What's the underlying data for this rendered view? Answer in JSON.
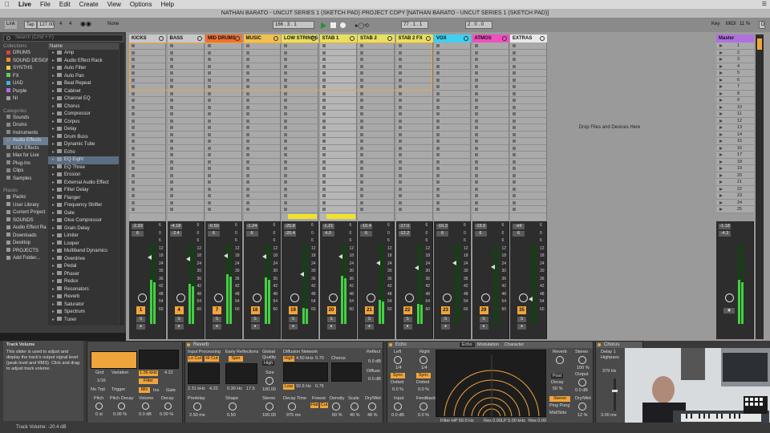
{
  "menubar": {
    "app": "Live",
    "items": [
      "File",
      "Edit",
      "Create",
      "View",
      "Options",
      "Help"
    ]
  },
  "title": "NATHAN BARATO - UNCUT SERIES 1 (SKETCH PAD) PROJECT COPY  [NATHAN BARATO - UNCUT SERIES 1 (SKETCH PAD)]",
  "transport": {
    "link": "Link",
    "tap": "Tap",
    "tempo": "127.00",
    "sig_num": "4",
    "sig_den": "4",
    "quant": "None",
    "pos": "166 .  3 .  1",
    "loop_start": "1",
    "loop_len": "77 .  1 .  1",
    "pos2": "2 .  0 .  0",
    "key": "Key",
    "midi": "MIDI",
    "cpu": "11 %",
    "d": "D"
  },
  "search": {
    "placeholder": "Search (Cmd + F)"
  },
  "sidebar": {
    "collections_h": "Collections",
    "collections": [
      {
        "label": "DRUMS",
        "color": "#e04040"
      },
      {
        "label": "SOUND DESIGN",
        "color": "#f08a30"
      },
      {
        "label": "SYNTHS",
        "color": "#e8d040"
      },
      {
        "label": "FX",
        "color": "#5ad05a"
      },
      {
        "label": "UAD",
        "color": "#40b0e0"
      },
      {
        "label": "Purple",
        "color": "#b070e0"
      },
      {
        "label": "NI",
        "color": "#a0a0a0"
      }
    ],
    "categories_h": "Categories",
    "categories": [
      "Sounds",
      "Drums",
      "Instruments",
      "Audio Effects",
      "MIDI Effects",
      "Max for Live",
      "Plug-Ins",
      "Clips",
      "Samples"
    ],
    "places_h": "Places",
    "places": [
      "Packs",
      "User Library",
      "Current Project",
      "SOUNDS",
      "Audio Effect Ra",
      "Downloads",
      "Desktop",
      "PROJECTS",
      "Add Folder..."
    ]
  },
  "browser": {
    "name_header": "Name",
    "items": [
      "Amp",
      "Audio Effect Rack",
      "Auto Filter",
      "Auto Pan",
      "Beat Repeat",
      "Cabinet",
      "Channel EQ",
      "Chorus",
      "Compressor",
      "Corpus",
      "Delay",
      "Drum Buss",
      "Dynamic Tube",
      "Echo",
      "EQ Eight",
      "EQ Three",
      "Erosion",
      "External Audio Effect",
      "Filter Delay",
      "Flanger",
      "Frequency Shifter",
      "Gate",
      "Glue Compressor",
      "Grain Delay",
      "Limiter",
      "Looper",
      "Multiband Dynamics",
      "Overdrive",
      "Pedal",
      "Phaser",
      "Redux",
      "Resonators",
      "Reverb",
      "Saturator",
      "Spectrum",
      "Tuner"
    ],
    "selected": "EQ Eight"
  },
  "tracks": [
    {
      "name": "KICKS",
      "color": "#c8c8c8",
      "vol": "-2.33",
      "pan": "6",
      "num": "1",
      "meter": 0.55
    },
    {
      "name": "BASS",
      "color": "#c8c8c8",
      "vol": "-4.18",
      "pan": "-2.4",
      "num": "4",
      "meter": 0.5
    },
    {
      "name": "MID DRUMS",
      "color": "#f07030",
      "vol": "-0.50",
      "pan": "6",
      "num": "7",
      "meter": 0.62
    },
    {
      "name": "MUSIC",
      "color": "#f0c050",
      "vol": "-1.24",
      "pan": "6",
      "num": "18",
      "meter": 0.58
    },
    {
      "name": "LOW STRINGS",
      "color": "#e8e060",
      "vol": "-25.8",
      "pan": "-20.4",
      "num": "19",
      "meter": 0.2
    },
    {
      "name": "STAB 1",
      "color": "#e8e060",
      "vol": "-1.21",
      "pan": "4.0",
      "num": "20",
      "meter": 0.6
    },
    {
      "name": "STAB 2",
      "color": "#e8e060",
      "vol": "-10.4",
      "pan": "6",
      "num": "21",
      "meter": 0.3
    },
    {
      "name": "STAB 2 FX",
      "color": "#e8e060",
      "vol": "-17.0",
      "pan": "-12.2",
      "num": "22",
      "meter": 0.25
    },
    {
      "name": "VOX",
      "color": "#40d0f0",
      "vol": "-10.3",
      "pan": "6",
      "num": "23",
      "meter": 0
    },
    {
      "name": "ATMOS",
      "color": "#f050c0",
      "vol": "-15.5",
      "pan": "6",
      "num": "29",
      "meter": 0
    },
    {
      "name": "EXTRAS",
      "color": "#e8e8e8",
      "vol": "-inf",
      "pan": "6",
      "num": "35",
      "meter": 0
    }
  ],
  "scale": [
    "6",
    "0",
    "6",
    "12",
    "18",
    "24",
    "30",
    "36",
    "42",
    "48",
    "54",
    "60"
  ],
  "drop_text": "Drop Files and Devices Here",
  "master": {
    "name": "Master",
    "vol": "-1.18",
    "pan": "-4.3",
    "scenes": [
      "1",
      "2",
      "3",
      "4",
      "5",
      "6",
      "7",
      "8",
      "9",
      "10",
      "11",
      "12",
      "13",
      "14",
      "15",
      "16",
      "17",
      "18",
      "19",
      "20",
      "21",
      "22",
      "23",
      "24",
      "25"
    ]
  },
  "info": {
    "title": "Track Volume",
    "body": "This slider is used to adjust and display the track's output signal level (peak level and RMS). Click and drag to adjust track volume."
  },
  "status": "Track Volume: -20.4 dB",
  "devices": {
    "track_volume": {
      "grid": "Grid",
      "variation": "Variation",
      "freq": "1.56 kHz",
      "val": "4.22",
      "no_trpl": "No Trpl",
      "trigger": "Trigger",
      "filter": "Filter",
      "mix": "Mix",
      "ins": "Ins",
      "gate": "Gate",
      "pitch": "Pitch",
      "pitch_decay": "Pitch Decay",
      "volume": "Volume",
      "decay": "Decay",
      "pitch_v": "0 st",
      "pd_v": "0.00 %",
      "vol_v": "0.0 dB",
      "dec_v": "0.00 %",
      "g1": "1/16"
    },
    "reverb": {
      "title": "Reverb",
      "input": "Input Processing",
      "early": "Early Reflections",
      "global": "Global",
      "quality": "Quality",
      "high": "High",
      "diffusion": "Diffusion Network",
      "reflect": "Reflect",
      "lo_cut": "Lo Cut",
      "hi_cut": "Hi Cut",
      "spin": "Spin",
      "f1": "2.31 kHz",
      "v1": "4.22",
      "f2": "0.30 Hz",
      "v2": "17.5",
      "size": "Size",
      "size_v": "100.00",
      "high_l": "High",
      "hf": "4.50 kHz",
      "hv": "0.70",
      "chorus": "Chorus",
      "low": "Low",
      "lf": "92.6 Hz",
      "lv": "0.75",
      "diffuse": "Diffuse",
      "predelay": "Predelay",
      "predelay_v": "2.50 ms",
      "shape": "Shape",
      "shape_v": "0.50",
      "stereo": "Stereo",
      "stereo_v": "100.00",
      "decay_time": "Decay Time",
      "decay_v": "975 ms",
      "freeze": "Freeze",
      "flat": "Flat",
      "cut": "Cut",
      "density": "Density",
      "density_v": "60 %",
      "scale": "Scale",
      "scale_v": "40 %",
      "drywet": "Dry/Wet",
      "drywet_v": "48 %",
      "reflect_v": "0.0 dB",
      "diffuse_v": "0.0 dB"
    },
    "echo": {
      "title": "Echo",
      "tabs": [
        "Echo",
        "Modulation",
        "Character"
      ],
      "left": "Left",
      "right": "Right",
      "l_div": "1/4",
      "r_div": "1/4",
      "sync": "Sync",
      "dotted": "Dotted",
      "l_pct": "0.0 %",
      "r_pct": "0.0 %",
      "input": "Input",
      "input_v": "0.0 dB",
      "feedback": "Feedback",
      "feedback_v": "0.0 %",
      "filter": "Filter HP 50.0 Hz",
      "res1": "Res 0.00",
      "lp": "LP 5.00 kHz",
      "res2": "Res 0.00",
      "reverb": "Reverb",
      "post": "Post",
      "decay": "Decay",
      "decay_v": "50 %",
      "stereo": "Stereo",
      "stereo_v": "100 %",
      "output": "Output",
      "output_v": "0.0 dB",
      "pingpong": "Ping Pong",
      "midside": "Mid/Side",
      "drywet": "Dry/Wet",
      "drywet_v": "12 %"
    },
    "chorus": {
      "title": "Chorus",
      "delay1": "Delay 1",
      "highpass": "Highpass",
      "hp_v": "379 Hz",
      "d_v": "3.00 ms",
      "de": "De"
    }
  }
}
